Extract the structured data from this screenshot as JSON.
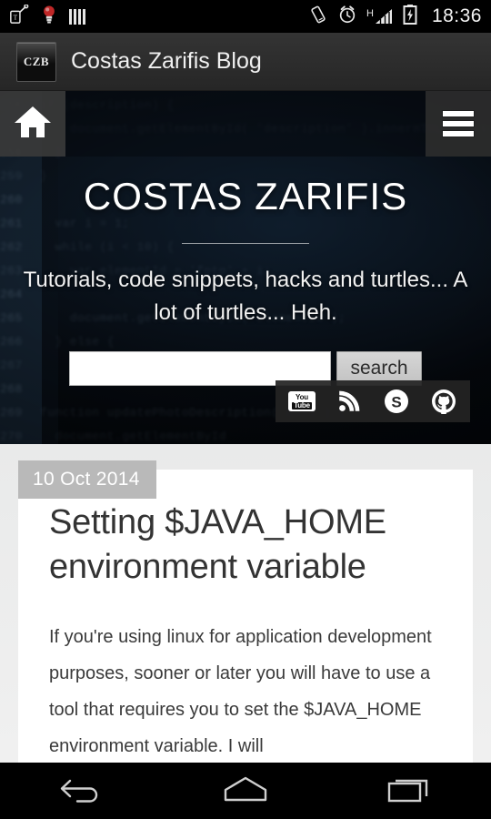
{
  "statusbar": {
    "icons_left": [
      "tmobile-key-icon",
      "lightbulb-notification-icon",
      "signal-bars-icon"
    ],
    "icons_right": [
      "vibrate-mode-icon",
      "alarm-clock-icon",
      "hspa-signal-icon",
      "battery-charging-icon"
    ],
    "network_label": "H",
    "clock": "18:36"
  },
  "appbar": {
    "icon_label": "CZB",
    "title": "Costas Zarifis Blog"
  },
  "sitenav": {
    "home_label": "home-icon",
    "menu_label": "hamburger-menu-icon"
  },
  "hero": {
    "title": "COSTAS ZARIFIS",
    "tagline": "Tutorials, code snippets, hacks and turtles... A lot of turtles... Heh.",
    "background_code_lines": [
      {
        "num": "256",
        "text": "if (description) {"
      },
      {
        "num": "257",
        "text": "    document.getElementById( 'description' ).innerHTML = description;"
      },
      {
        "num": "258",
        "text": "  }"
      },
      {
        "num": "259",
        "text": "}"
      },
      {
        "num": "260",
        "text": ""
      },
      {
        "num": "261",
        "text": "  var i = 1;"
      },
      {
        "num": "262",
        "text": "  while (i < 10) {"
      },
      {
        "num": "263",
        "text": "    var elementId = 'foto' + i;"
      },
      {
        "num": "264",
        "text": ""
      },
      {
        "num": "265",
        "text": "    document.getElementById( elementId );"
      },
      {
        "num": "266",
        "text": "  } else {"
      },
      {
        "num": "267",
        "text": "    document.getElementById( elementBig );"
      },
      {
        "num": "268",
        "text": ""
      },
      {
        "num": "269",
        "text": "function updatePhotoDescription( cell ) {"
      },
      {
        "num": "270",
        "text": "  document.getElementById"
      }
    ]
  },
  "search": {
    "value": "",
    "placeholder": "",
    "button_label": "search"
  },
  "social": {
    "items": [
      {
        "name": "youtube-icon",
        "top": "You",
        "bottom": "Tube"
      },
      {
        "name": "rss-icon"
      },
      {
        "name": "skype-icon",
        "letter": "S"
      },
      {
        "name": "github-icon"
      }
    ]
  },
  "post": {
    "date": "10 Oct 2014",
    "title": "Setting $JAVA_HOME environment variable",
    "body": "If you're using linux for application development purposes, sooner or later you will have to use a tool that requires you to set the $JAVA_HOME environment variable. I will"
  },
  "androidnav": {
    "back": "back-icon",
    "home": "home-icon",
    "recents": "recent-apps-icon"
  },
  "colors": {
    "appbar_bg": "#2b2b2b",
    "hero_bg": "#05080c",
    "page_bg": "#eceded",
    "card_bg": "#ffffff",
    "date_badge_bg": "#b9b9b9",
    "search_button_bg": "#c9c9c9",
    "accent_text": "#ffffff"
  }
}
